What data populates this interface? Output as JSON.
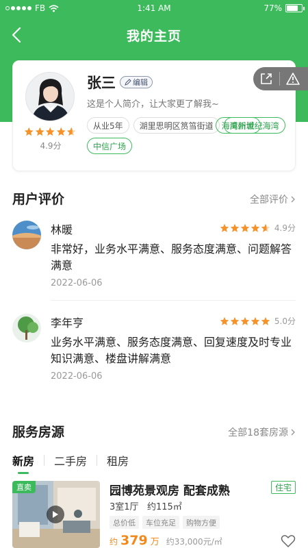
{
  "status_bar": {
    "carrier": "FB",
    "time": "1:41 AM",
    "battery": "77%",
    "battery_level": 0.77
  },
  "header": {
    "title": "我的主页"
  },
  "profile": {
    "name": "张三",
    "edit_label": "编辑",
    "intro": "这是个人简介，让大家更了解我~",
    "score": "4.9分",
    "rating": 4.9,
    "tags": [
      {
        "label": "从业5年",
        "style": "gray"
      },
      {
        "label": "湖里思明区筼筜街道",
        "style": "gray"
      },
      {
        "label": "禹州世纪海湾",
        "style": "green"
      },
      {
        "label": "海湾新城",
        "style": "green"
      },
      {
        "label": "中信广场",
        "style": "green"
      }
    ]
  },
  "reviews_section": {
    "title": "用户评价",
    "more": "全部评价",
    "items": [
      {
        "name": "林暖",
        "score": "4.9分",
        "rating": 4.9,
        "text": "非常好，业务水平满意、服务态度满意、问题解答满意",
        "date": "2022-06-06"
      },
      {
        "name": "李年亨",
        "score": "5.0分",
        "rating": 5.0,
        "text": "业务水平满意、服务态度满意、回复速度及时专业知识满意、楼盘讲解满意",
        "date": "2022-06-06"
      }
    ]
  },
  "listings_section": {
    "title": "服务房源",
    "more": "全部18套房源",
    "tabs": [
      "新房",
      "二手房",
      "租房"
    ],
    "active_tab": 0,
    "listing": {
      "badge": "直卖",
      "title": "园博苑景观房  配套成熟",
      "type": "住宅",
      "spec": "3室1厅   约115㎡",
      "features": [
        "总价低",
        "车位充足",
        "购物方便"
      ],
      "price_prefix": "约",
      "price": "379",
      "price_unit": "万",
      "unit_price": "约33,000元/㎡"
    }
  },
  "colors": {
    "brand_green": "#3dbb5c",
    "star_orange": "#f5922a",
    "price_orange": "#f08a1c"
  }
}
